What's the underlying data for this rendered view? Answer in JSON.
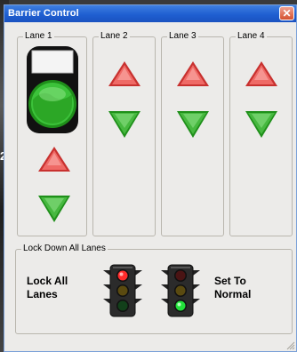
{
  "window": {
    "title": "Barrier Control",
    "close_glyph": "✕"
  },
  "background": {
    "partial_digit": "2"
  },
  "lanes": [
    {
      "label": "Lane 1",
      "has_indicator": true
    },
    {
      "label": "Lane 2"
    },
    {
      "label": "Lane 3"
    },
    {
      "label": "Lane 4"
    }
  ],
  "lockdown": {
    "group_label": "Lock Down All Lanes",
    "lock_label_line1": "Lock All",
    "lock_label_line2": "Lanes",
    "normal_label_line1": "Set To",
    "normal_label_line2": "Normal"
  },
  "icons": {
    "raise": "up-arrow-icon",
    "lower": "down-arrow-icon",
    "lock": "traffic-light-red-icon",
    "normal": "traffic-light-green-icon",
    "indicator": "barrier-status-indicator-icon"
  },
  "colors": {
    "title_bar": "#1f5fd1",
    "panel_bg": "#ecebe9",
    "raise_red": "#e85a58",
    "lower_green": "#3fb03a",
    "indicator_green": "#2fae28"
  }
}
